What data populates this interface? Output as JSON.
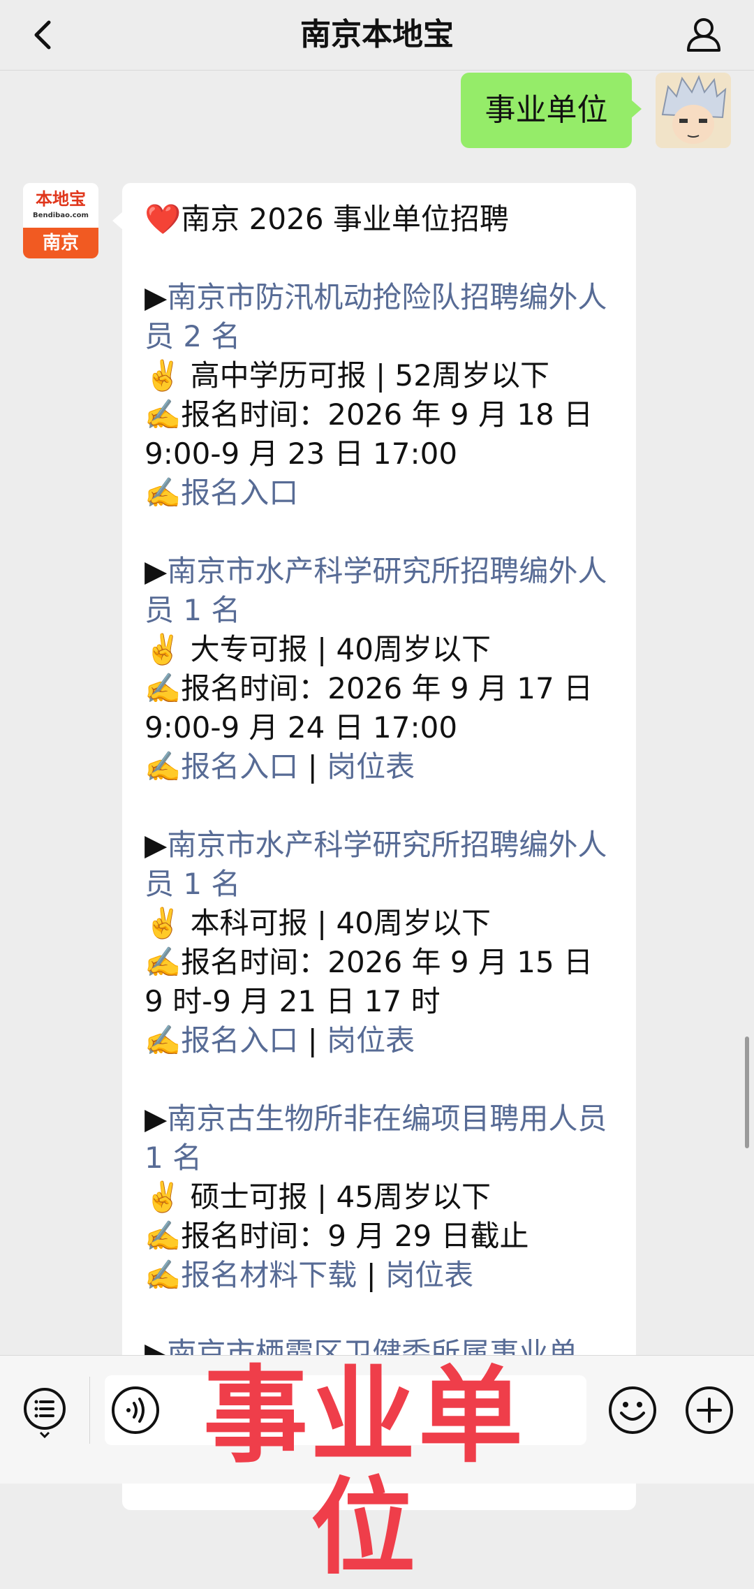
{
  "header": {
    "title": "南京本地宝",
    "back_icon": "chevron-left-icon",
    "profile_icon": "person-icon"
  },
  "my_message": {
    "text": "事业单位"
  },
  "official_account": {
    "avatar_brand": "本地宝",
    "avatar_domain": "Bendibao.com",
    "avatar_city": "南京"
  },
  "message": {
    "heading_emoji": "❤️",
    "heading": "南京 2026 事业单位招聘",
    "jobs": [
      {
        "bullet": "▶",
        "title": "南京市防汛机动抢险队招聘编外人员 2 名",
        "req_emoji": "✌️",
        "requirement": "高中学历可报 | 52周岁以下",
        "time_emoji": "✍️",
        "time": "报名时间：2026 年 9 月 18 日 9:00-9 月 23 日 17:00",
        "link_emoji": "✍️",
        "links": [
          "报名入口"
        ],
        "link_separator": " | "
      },
      {
        "bullet": "▶",
        "title": "南京市水产科学研究所招聘编外人员 1 名",
        "req_emoji": "✌️",
        "requirement": "大专可报 | 40周岁以下",
        "time_emoji": "✍️",
        "time": "报名时间：2026 年 9 月 17 日 9:00-9 月 24 日 17:00",
        "link_emoji": "✍️",
        "links": [
          "报名入口",
          "岗位表"
        ],
        "link_separator": " | "
      },
      {
        "bullet": "▶",
        "title": "南京市水产科学研究所招聘编外人员 1 名",
        "req_emoji": "✌️",
        "requirement": "本科可报 | 40周岁以下",
        "time_emoji": "✍️",
        "time": "报名时间：2026 年 9 月 15 日 9 时-9 月 21 日 17 时",
        "link_emoji": "✍️",
        "links": [
          "报名入口",
          "岗位表"
        ],
        "link_separator": " | "
      },
      {
        "bullet": "▶",
        "title": "南京古生物所非在编项目聘用人员 1 名",
        "req_emoji": "✌️",
        "requirement": "硕士可报 | 45周岁以下",
        "time_emoji": "✍️",
        "time": "报名时间：9 月 29 日截止",
        "link_emoji": "✍️",
        "links": [
          "报名材料下载",
          "岗位表"
        ],
        "link_separator": " | "
      },
      {
        "bullet": "▶",
        "title": "南京市栖霞区卫健委所属事业单",
        "partially_hidden": true
      }
    ]
  },
  "bottom_bar": {
    "menu_icon": "menu-list-icon",
    "voice_icon": "voice-icon",
    "emoji_icon": "smiley-icon",
    "plus_icon": "plus-icon",
    "overlay_caption": "事业单位"
  }
}
